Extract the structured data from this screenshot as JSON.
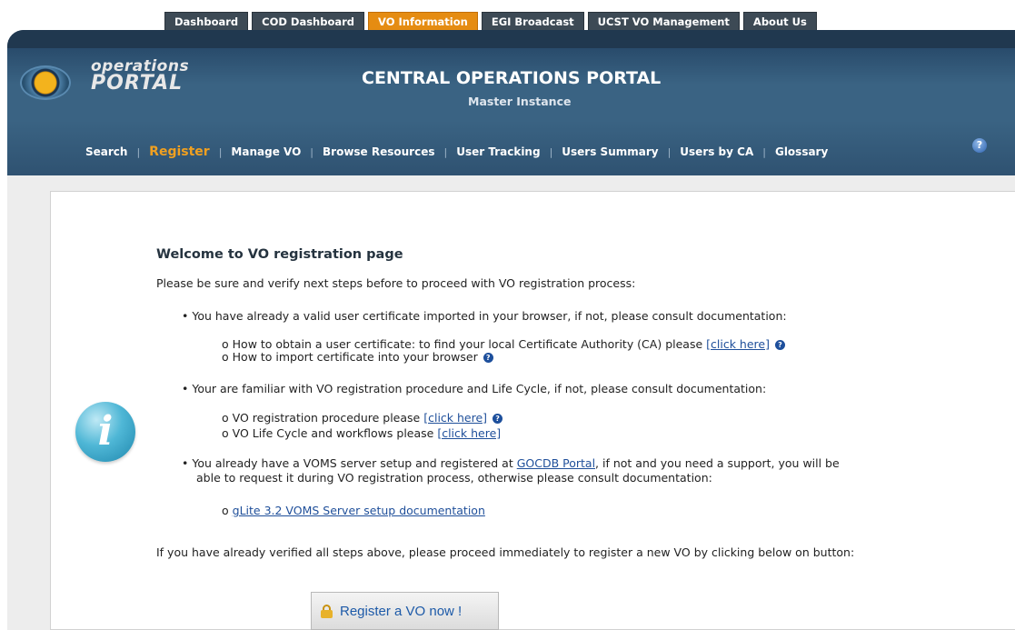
{
  "top_tabs": [
    "Dashboard",
    "COD Dashboard",
    "VO Information",
    "EGI Broadcast",
    "UCST VO Management",
    "About Us"
  ],
  "active_tab": "VO Information",
  "logo": {
    "line1": "operations",
    "line2": "PORTAL"
  },
  "portal": {
    "title": "CENTRAL OPERATIONS PORTAL",
    "subtitle": "Master Instance"
  },
  "subnav": [
    "Search",
    "Register",
    "Manage VO",
    "Browse Resources",
    "User Tracking",
    "Users Summary",
    "Users by CA",
    "Glossary"
  ],
  "subnav_active": "Register",
  "content": {
    "heading": "Welcome to VO registration page",
    "intro": "Please be sure and verify next steps before to proceed with VO registration process:",
    "b1": "You have already a valid user certificate imported in your browser, if not, please consult documentation:",
    "b1_1_text": "How to obtain a user certificate: to find your local Certificate Authority (CA) please ",
    "b1_1_link": "[click here]",
    "b1_2_text": "How to import certificate into your browser",
    "b2": "Your are familiar with VO registration procedure and Life Cycle, if not, please consult documentation:",
    "b2_1_text": "VO registration procedure please ",
    "b2_1_link": "[click here]",
    "b2_2_text": "VO Life Cycle and workflows please ",
    "b2_2_link": "[click here]",
    "b3_a": "You already have a VOMS server setup and registered at ",
    "b3_link": "GOCDB Portal",
    "b3_b": ", if not and you need a support, you will be",
    "b3_c": "able to request it during VO registration process, otherwise please consult documentation:",
    "b3_1_link": "gLite 3.2 VOMS Server setup documentation",
    "outro": "If you have already verified all steps above, please proceed immediately to register a new VO by clicking below on button:",
    "button": "Register a VO now !"
  },
  "colors": {
    "accent": "#e58c12",
    "header": "#3a6383",
    "link": "#1f4f9a"
  }
}
